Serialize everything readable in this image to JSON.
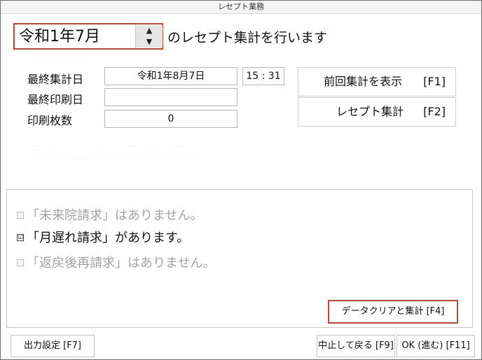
{
  "window": {
    "title": "レセプト業務"
  },
  "header": {
    "month": "令和1年7月",
    "spin_up": "▲",
    "spin_down": "▼",
    "suffix": "のレセプト集計を行います"
  },
  "form": {
    "last_aggregate_label": "最終集計日",
    "last_aggregate_date": "令和1年8月7日",
    "last_aggregate_time": "15 : 31",
    "last_print_label": "最終印刷日",
    "last_print_value": "",
    "print_count_label": "印刷枚数",
    "print_count_value": "0"
  },
  "side_buttons": {
    "show_previous": {
      "label": "前回集計を表示",
      "key": "[F1]"
    },
    "aggregate": {
      "label": "レセプト集計",
      "key": "[F2]"
    }
  },
  "status": {
    "items": [
      {
        "check": "",
        "text": "「未来院請求」はありません。"
      },
      {
        "check": "☑",
        "text": "「月遅れ請求」があります。"
      },
      {
        "check": "",
        "text": "「返戻後再請求」はありません。"
      }
    ]
  },
  "panel": {
    "clear_button": "データクリアと集計 [F4]"
  },
  "footer": {
    "output_settings": "出力設定 [F7]",
    "cancel_return": "中止して戻る [F9]",
    "ok_proceed": "OK (進む) [F11]"
  }
}
